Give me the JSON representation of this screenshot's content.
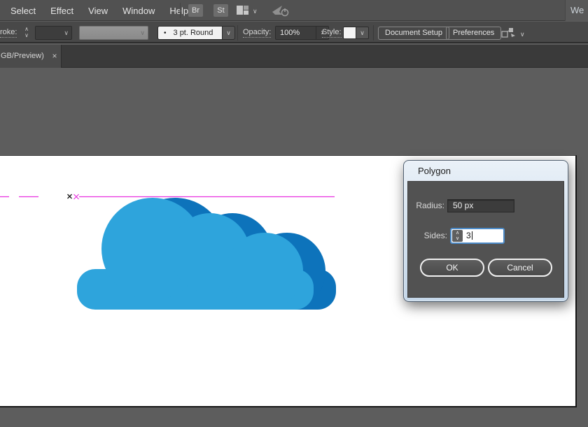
{
  "menubar": {
    "items": [
      {
        "label": "Select"
      },
      {
        "label": "Effect"
      },
      {
        "label": "View"
      },
      {
        "label": "Window"
      },
      {
        "label": "Help"
      }
    ],
    "bridge_button": "Br",
    "stock_button": "St",
    "workspace_button": "We"
  },
  "control_bar": {
    "stroke_label": "roke:",
    "brush_bullet": "•",
    "brush_value": "3 pt. Round",
    "opacity_label": "Opacity:",
    "opacity_value": "100%",
    "style_label": "Style:",
    "document_setup": "Document Setup",
    "preferences": "Preferences"
  },
  "tabbar": {
    "active_tab": "GB/Preview)",
    "close": "×"
  },
  "dialog": {
    "title": "Polygon",
    "radius_label": "Radius:",
    "radius_value": "50 px",
    "sides_label": "Sides:",
    "sides_value": "3",
    "ok": "OK",
    "cancel": "Cancel"
  },
  "canvas": {
    "cloud_front_color": "#2ea4dc",
    "cloud_back_color": "#0d73bb",
    "guide_color": "#e832e0"
  },
  "glyphs": {
    "chevron_down": "∨",
    "chevron_up": "∧",
    "arrow_right": "›"
  }
}
